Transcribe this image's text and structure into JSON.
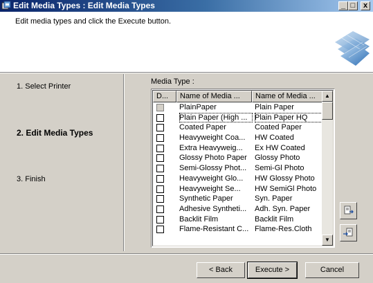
{
  "window": {
    "title": "Edit Media Types : Edit Media Types",
    "minimize": "_",
    "maximize": "□",
    "close": "x"
  },
  "header": {
    "description": "Edit media types and click the Execute button."
  },
  "steps": [
    {
      "label": "1.  Select Printer",
      "active": false
    },
    {
      "label": "2.  Edit Media Types",
      "active": true
    },
    {
      "label": "3.  Finish",
      "active": false
    }
  ],
  "media_type": {
    "label": "Media Type :",
    "columns": [
      "D...",
      "Name of Media ...",
      "Name of Media ..."
    ],
    "rows": [
      {
        "checked": false,
        "disabled": true,
        "name": "PlainPaper",
        "display": "Plain Paper"
      },
      {
        "checked": false,
        "disabled": false,
        "name": "Plain Paper (High ...",
        "display": "Plain Paper HQ",
        "focused": true
      },
      {
        "checked": false,
        "disabled": false,
        "name": "Coated Paper",
        "display": "Coated Paper"
      },
      {
        "checked": false,
        "disabled": false,
        "name": "Heavyweight Coa...",
        "display": "HW Coated"
      },
      {
        "checked": false,
        "disabled": false,
        "name": "Extra Heavyweig...",
        "display": "Ex HW Coated"
      },
      {
        "checked": false,
        "disabled": false,
        "name": "Glossy Photo Paper",
        "display": "Glossy Photo"
      },
      {
        "checked": false,
        "disabled": false,
        "name": "Semi-Glossy Phot...",
        "display": "Semi-Gl Photo"
      },
      {
        "checked": false,
        "disabled": false,
        "name": "Heavyweight Glo...",
        "display": "HW Glossy Photo"
      },
      {
        "checked": false,
        "disabled": false,
        "name": "Heavyweight Se...",
        "display": "HW SemiGl Photo"
      },
      {
        "checked": false,
        "disabled": false,
        "name": "Synthetic Paper",
        "display": "Syn. Paper"
      },
      {
        "checked": false,
        "disabled": false,
        "name": "Adhesive Syntheti...",
        "display": "Adh. Syn. Paper"
      },
      {
        "checked": false,
        "disabled": false,
        "name": "Backlit Film",
        "display": "Backlit Film"
      },
      {
        "checked": false,
        "disabled": false,
        "name": "Flame-Resistant C...",
        "display": "Flame-Res.Cloth"
      }
    ]
  },
  "side_buttons": {
    "export_icon": "export-icon",
    "import_icon": "import-icon"
  },
  "footer": {
    "back": "< Back",
    "execute": "Execute >",
    "cancel": "Cancel"
  }
}
